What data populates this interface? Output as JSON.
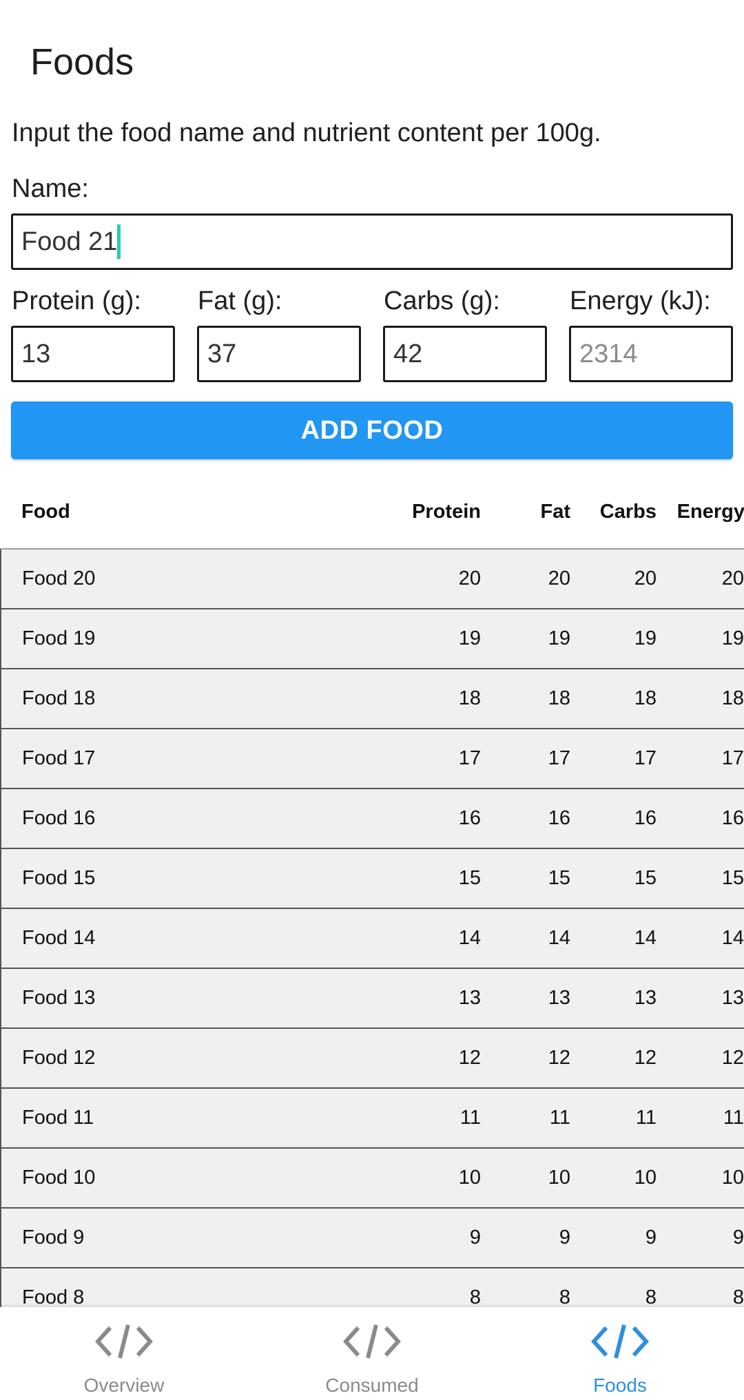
{
  "header": {
    "title": "Foods"
  },
  "form": {
    "instruction": "Input the food name and nutrient content per 100g.",
    "name_label": "Name:",
    "name_value": "Food 21",
    "protein_label": "Protein (g):",
    "protein_value": "13",
    "fat_label": "Fat (g):",
    "fat_value": "37",
    "carbs_label": "Carbs (g):",
    "carbs_value": "42",
    "energy_label": "Energy (kJ):",
    "energy_placeholder": "2314",
    "add_button_label": "ADD FOOD"
  },
  "table": {
    "headers": [
      "Food",
      "Protein",
      "Fat",
      "Carbs",
      "Energy"
    ],
    "rows": [
      [
        "Food 20",
        "20",
        "20",
        "20",
        "20"
      ],
      [
        "Food 19",
        "19",
        "19",
        "19",
        "19"
      ],
      [
        "Food 18",
        "18",
        "18",
        "18",
        "18"
      ],
      [
        "Food 17",
        "17",
        "17",
        "17",
        "17"
      ],
      [
        "Food 16",
        "16",
        "16",
        "16",
        "16"
      ],
      [
        "Food 15",
        "15",
        "15",
        "15",
        "15"
      ],
      [
        "Food 14",
        "14",
        "14",
        "14",
        "14"
      ],
      [
        "Food 13",
        "13",
        "13",
        "13",
        "13"
      ],
      [
        "Food 12",
        "12",
        "12",
        "12",
        "12"
      ],
      [
        "Food 11",
        "11",
        "11",
        "11",
        "11"
      ],
      [
        "Food 10",
        "10",
        "10",
        "10",
        "10"
      ],
      [
        "Food 9",
        "9",
        "9",
        "9",
        "9"
      ],
      [
        "Food 8",
        "8",
        "8",
        "8",
        "8"
      ]
    ]
  },
  "nav": {
    "items": [
      {
        "label": "Overview",
        "icon": "code-icon",
        "active": false
      },
      {
        "label": "Consumed",
        "icon": "code-icon",
        "active": false
      },
      {
        "label": "Foods",
        "icon": "code-icon",
        "active": true
      }
    ],
    "active_color": "#2f8fdc",
    "inactive_color": "#8a8a8a"
  },
  "theme": {
    "button_color": "#2196f3",
    "caret_color": "#1fd1b6"
  }
}
